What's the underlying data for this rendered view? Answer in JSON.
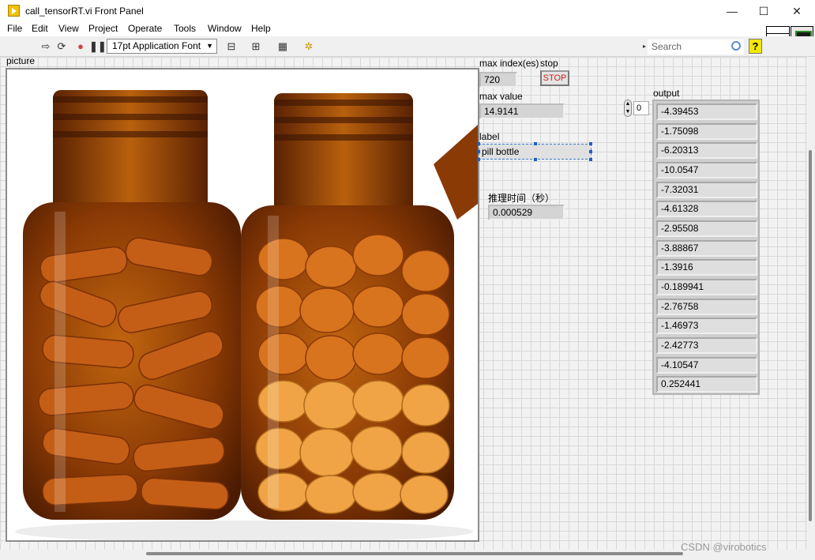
{
  "window": {
    "title": "call_tensorRT.vi Front Panel",
    "minimize": "—",
    "maximize": "☐",
    "close": "✕"
  },
  "menu": [
    "File",
    "Edit",
    "View",
    "Project",
    "Operate",
    "Tools",
    "Window",
    "Help"
  ],
  "toolbar": {
    "font": "17pt Application Font",
    "search_placeholder": "Search",
    "help": "?"
  },
  "picture": {
    "label": "picture"
  },
  "max_index": {
    "label": "max index(es)",
    "value": "720"
  },
  "stop": {
    "label": "stop",
    "button": "STOP"
  },
  "max_value": {
    "label": "max value",
    "value": "14.9141"
  },
  "class_label": {
    "label": "label",
    "value": "pill bottle"
  },
  "inference_time": {
    "label": "推理时间（秒）",
    "value": "0.000529"
  },
  "output": {
    "label": "output",
    "index": "0",
    "values": [
      "-4.39453",
      "-1.75098",
      "-6.20313",
      "-10.0547",
      "-7.32031",
      "-4.61328",
      "-2.95508",
      "-3.88867",
      "-1.3916",
      "-0.189941",
      "-2.76758",
      "-1.46973",
      "-2.42773",
      "-4.10547",
      "0.252441"
    ]
  },
  "watermark": "CSDN @virobotics",
  "colors": {
    "panel_grid": "#d8d8d8",
    "stop_text": "#d02020",
    "amber_glass": "#8a3a05"
  }
}
